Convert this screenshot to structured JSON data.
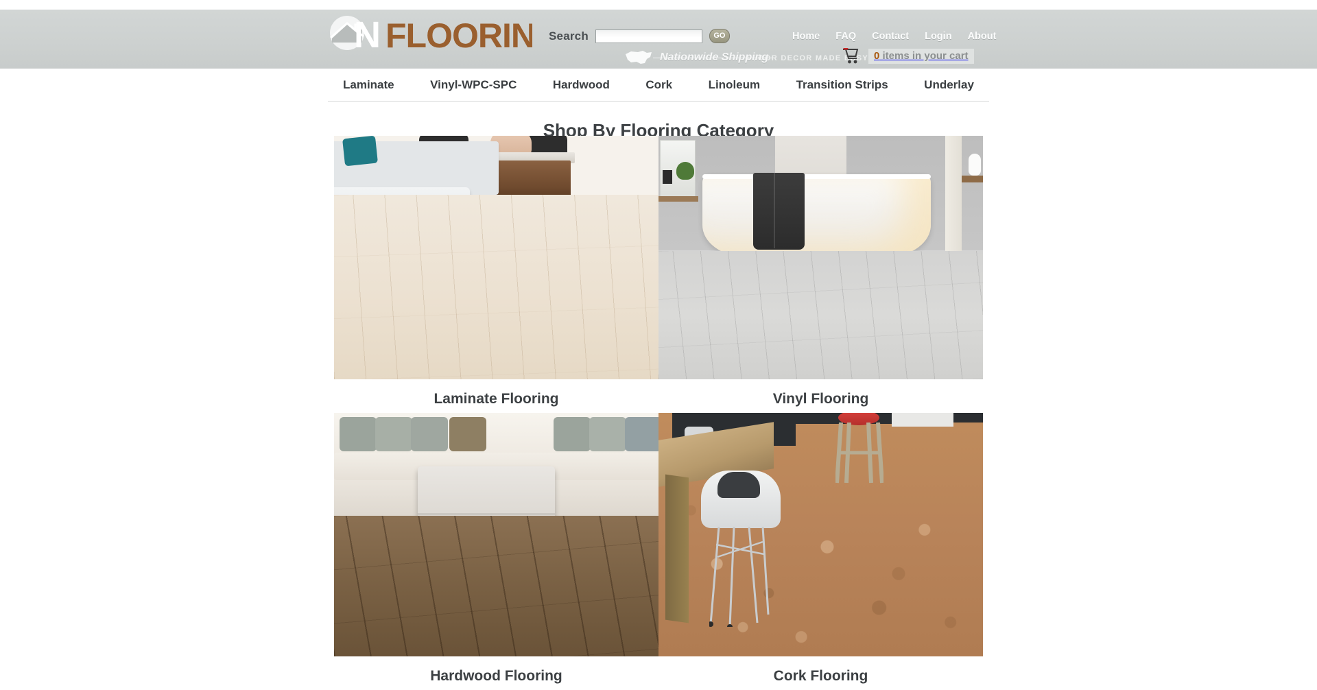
{
  "header": {
    "logo": {
      "name_part1": "ON",
      "name_part2": "FLOORING",
      "tagline": "FLOOR DECOR MADE EASY",
      "icon": "house-circle-logo-icon"
    },
    "search": {
      "label": "Search",
      "value": "",
      "placeholder": "",
      "button_label": "GO",
      "icon": "search-input"
    },
    "top_nav": [
      {
        "label": "Home"
      },
      {
        "label": "FAQ"
      },
      {
        "label": "Contact"
      },
      {
        "label": "Login"
      },
      {
        "label": "About"
      }
    ],
    "shipping": {
      "text": "Nationwide Shipping",
      "icon": "usa-map-icon"
    },
    "cart": {
      "icon": "shopping-cart-icon",
      "count": "0",
      "label": "items in your cart"
    }
  },
  "main_nav": [
    {
      "label": "Laminate"
    },
    {
      "label": "Vinyl-WPC-SPC"
    },
    {
      "label": "Hardwood"
    },
    {
      "label": "Cork"
    },
    {
      "label": "Linoleum"
    },
    {
      "label": "Transition Strips"
    },
    {
      "label": "Underlay"
    }
  ],
  "main": {
    "title": "Shop By Flooring Category",
    "categories": [
      {
        "label": "Laminate Flooring",
        "image": "living-room-light-laminate-floor-photo"
      },
      {
        "label": "Vinyl Flooring",
        "image": "bathroom-bathtub-gray-vinyl-floor-photo"
      },
      {
        "label": "Hardwood Flooring",
        "image": "living-room-sectional-dark-hardwood-floor-photo"
      },
      {
        "label": "Cork Flooring",
        "image": "kitchen-table-chair-cork-floor-photo"
      }
    ]
  },
  "colors": {
    "header_band": "#cdd1d0",
    "brand_brown": "#a8590f",
    "nav_text": "#3b3f42",
    "page_bg": "#ffffff",
    "go_button": "#97957f"
  }
}
